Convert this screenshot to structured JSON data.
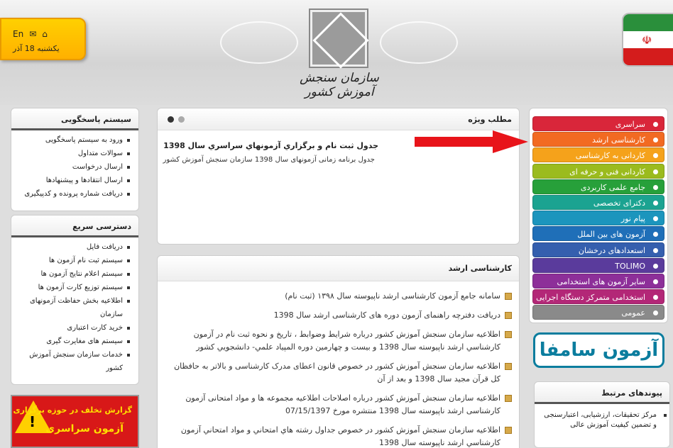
{
  "header": {
    "logo_text": "سازمان سنجش آموزش کشور"
  },
  "infobox": {
    "lang": "En",
    "mail_icon": "mail-icon",
    "home_icon": "home-icon",
    "date": "یکشنبه 18 آذر"
  },
  "colors": {
    "accent": "#ffc000",
    "arrow": "#e8141a"
  },
  "left": {
    "response": {
      "title": "سیستم پاسخگویی",
      "items": [
        "ورود به سیستم پاسخگویی",
        "سوالات متداول",
        "ارسال درخواست",
        "ارسال انتقادها و پیشنهادها",
        "دریافت شماره پرونده و کدپیگیری"
      ]
    },
    "quick": {
      "title": "دسترسی سریع",
      "items": [
        "دریافت فایل",
        "سیستم ثبت نام آزمون ها",
        "سیستم اعلام نتایج آزمون ها",
        "سیستم توزیع کارت آزمون ها",
        "اطلاعیه بخش حفاظت آزمونهای سازمان",
        "خرید کارت اعتباری",
        "سیستم های مغایرت گیری",
        "خدمات سازمان سنجش آموزش کشور"
      ]
    },
    "report": {
      "line1": "گزارش تخلف در حوزه برگزاری",
      "line2": "آزمون سراسری",
      "icon": "warning-icon"
    }
  },
  "feature": {
    "title": "مطلب ویژه",
    "item_title": "جدول ثبت نام و برگزاري آزمونهاي سراسري سال 1398",
    "item_body": "جدول برنامه زمانی آزمونهای سال 1398 سازمان سنجش آموزش کشور"
  },
  "karshenasi": {
    "title": "کارشناسی ارشد",
    "items": [
      "سامانه جامع آزمون کارشناسی ارشد ناپیوسته سال ۱۳۹۸ (ثبت نام)",
      "دریافت دفترچه راهنمای آزمون دوره های کارشناسی ارشد سال 1398",
      "اطلاعيه سازمان سنجش آموزش كشور درباره شرايط وضوابط ، تاريخ و نحوه ثبت نام در آزمون كارشناسي ارشد ناپيوسته سال 1398 و بيست و چهارمين دوره المپياد علمي- دانشجويي كشور",
      "اطلاعیه سازمان سنجش آموزش کشور در خصوص قانون اعطای مدرک کارشناسی و بالاتر به حافظان کل قرآن مجید سال 1398 و بعد از آن",
      "اطلاعیه سازمان سنجش آموزش کشور درباره اصلاحات اطلاعیه مجموعه ها و مواد امتحانی آزمون کارشناسی ارشد ناپیوسته سال 1398 منتشره مورخ 07/15/1397",
      "اطلاعيه سازمان سنجش آموزش كشور در خصوص جداول رشته هاي امتحاني و مواد امتحاني آزمون كارشناسي ارشد ناپيوسته سال 1398"
    ]
  },
  "categories": [
    {
      "label": "سراسری",
      "color": "#d9263a"
    },
    {
      "label": "کارشناسی ارشد",
      "color": "#f26a22"
    },
    {
      "label": "کاردانی به کارشناسی",
      "color": "#f5a21b"
    },
    {
      "label": "کاردانی فنی و حرفه ای",
      "color": "#9bbb1e"
    },
    {
      "label": "جامع علمی کاربردی",
      "color": "#27a03a"
    },
    {
      "label": "دکترای تخصصی",
      "color": "#1ba391"
    },
    {
      "label": "پیام نور",
      "color": "#1c95bd"
    },
    {
      "label": "آزمون های بین الملل",
      "color": "#1f6fb8"
    },
    {
      "label": "استعدادهای درخشان",
      "color": "#355fae"
    },
    {
      "label": "TOLIMO",
      "color": "#5a3b9c"
    },
    {
      "label": "سایر آزمون های استخدامی",
      "color": "#8d2f99"
    },
    {
      "label": "استخدامی متمرکز دستگاه اجرایی",
      "color": "#b32777"
    },
    {
      "label": "عمومی",
      "color": "#8a8a8a"
    }
  ],
  "samfa": {
    "text": "آزمون سامفا"
  },
  "related": {
    "title": "پیوندهای مرتبط",
    "item": "مرکز تحقیقات، ارزشیابی، اعتبارسنجی و تضمین کیفیت آموزش عالی"
  }
}
